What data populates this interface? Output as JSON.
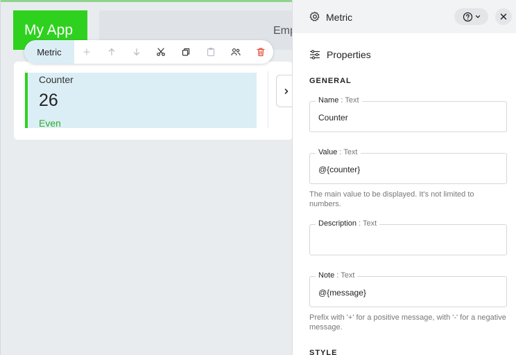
{
  "app": {
    "title": "My App",
    "header_text": "Emp"
  },
  "toolbar": {
    "label": "Metric",
    "buttons": [
      "add-icon",
      "move-up-icon",
      "move-down-icon",
      "cut-icon",
      "copy-icon",
      "paste-icon",
      "share-users-icon",
      "delete-icon"
    ]
  },
  "metric": {
    "name": "Counter",
    "value": "26",
    "note": "Even"
  },
  "colors": {
    "accent": "#2fd11f",
    "note_positive": "#2fae28",
    "delete": "#e24c3a"
  },
  "panel": {
    "title": "Metric",
    "section": "Properties",
    "general_title": "GENERAL",
    "style_title": "STYLE",
    "type_separator": " : ",
    "fields": [
      {
        "label": "Name",
        "type": "Text",
        "value": "Counter"
      },
      {
        "label": "Value",
        "type": "Text",
        "value": "@{counter}",
        "hint": "The main value to be displayed. It's not limited to numbers."
      },
      {
        "label": "Description",
        "type": "Text",
        "value": ""
      },
      {
        "label": "Note",
        "type": "Text",
        "value": "@{message}",
        "hint": "Prefix with '+' for a positive message, with '-' for a negative message."
      }
    ]
  }
}
